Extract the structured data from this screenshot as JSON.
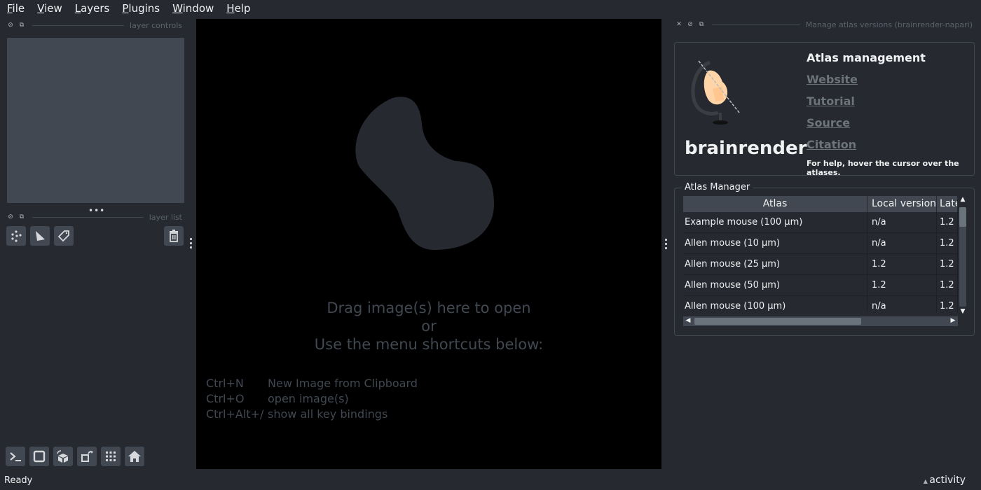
{
  "menubar": {
    "items": [
      {
        "label": "File",
        "u": "F",
        "rest": "ile"
      },
      {
        "label": "View",
        "u": "V",
        "rest": "iew"
      },
      {
        "label": "Layers",
        "u": "L",
        "rest": "ayers"
      },
      {
        "label": "Plugins",
        "u": "P",
        "rest": "lugins"
      },
      {
        "label": "Window",
        "u": "W",
        "rest": "indow"
      },
      {
        "label": "Help",
        "u": "H",
        "rest": "elp"
      }
    ]
  },
  "left": {
    "layer_controls_title": "layer controls",
    "layer_list_title": "layer list"
  },
  "canvas": {
    "welcome_line1": "Drag image(s) here to open",
    "welcome_line2": "or",
    "welcome_line3": "Use the menu shortcuts below:",
    "shortcuts": [
      {
        "key": "Ctrl+N",
        "desc": "New Image from Clipboard"
      },
      {
        "key": "Ctrl+O",
        "desc": "open image(s)"
      },
      {
        "key": "Ctrl+Alt+/",
        "desc": "show all key bindings"
      }
    ]
  },
  "right": {
    "dock_title": "Manage atlas versions (brainrender-napari)",
    "brand": "brainrender",
    "info_title": "Atlas management",
    "links": [
      "Website",
      "Tutorial",
      "Source",
      "Citation"
    ],
    "help_text": "For help, hover the cursor over the atlases.",
    "group_title": "Atlas Manager",
    "table": {
      "headers": [
        "Atlas",
        "Local version",
        "Latest version"
      ],
      "rows": [
        [
          "Example mouse (100 μm)",
          "n/a",
          "1.2"
        ],
        [
          "Allen mouse (10 μm)",
          "n/a",
          "1.2"
        ],
        [
          "Allen mouse (25 μm)",
          "1.2",
          "1.2"
        ],
        [
          "Allen mouse (50 μm)",
          "1.2",
          "1.2"
        ],
        [
          "Allen mouse (100 μm)",
          "n/a",
          "1.2"
        ]
      ]
    }
  },
  "status": {
    "text": "Ready",
    "activity_label": "activity"
  }
}
